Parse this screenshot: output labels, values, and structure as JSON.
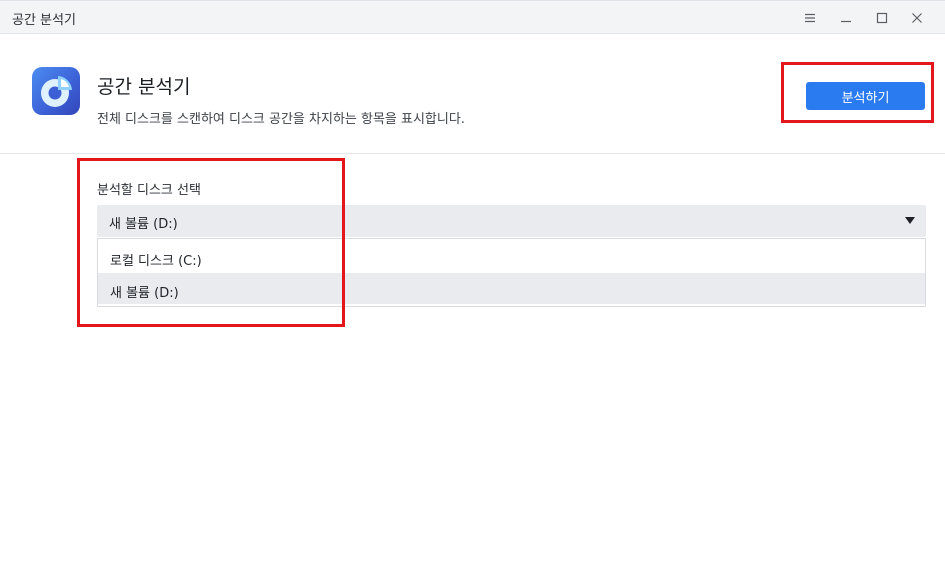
{
  "window": {
    "title": "공간 분석기",
    "controls": [
      "menu-icon",
      "minimize-icon",
      "maximize-icon",
      "close-icon"
    ]
  },
  "header": {
    "title": "공간 분석기",
    "subtitle": "전체 디스크를 스캔하여 디스크 공간을 차지하는 항목을 표시합니다.",
    "analyze_label": "분석하기",
    "icon": "space-analyzer-app-icon"
  },
  "disk_select": {
    "label": "분석할 디스크 선택",
    "selected": "새 볼륨 (D:)",
    "options": [
      {
        "label": "로컬 디스크 (C:)"
      },
      {
        "label": "새 볼륨 (D:)"
      }
    ]
  },
  "colors": {
    "accent": "#2b7bf0",
    "highlight": "#e3171b",
    "titlebar": "#f3f4f6",
    "select_bg": "#e9ebef"
  }
}
